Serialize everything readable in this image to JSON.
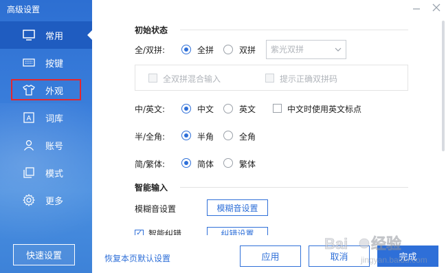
{
  "window": {
    "title": "高级设置"
  },
  "sidebar": {
    "items": [
      {
        "label": "常用",
        "icon": "monitor-icon",
        "active": true
      },
      {
        "label": "按键",
        "icon": "keyboard-icon",
        "active": false
      },
      {
        "label": "外观",
        "icon": "tshirt-icon",
        "active": false
      },
      {
        "label": "词库",
        "icon": "lexicon-icon",
        "active": false
      },
      {
        "label": "账号",
        "icon": "user-icon",
        "active": false
      },
      {
        "label": "模式",
        "icon": "mode-icon",
        "active": false
      },
      {
        "label": "更多",
        "icon": "gear-icon",
        "active": false
      }
    ],
    "quick_settings_label": "快速设置"
  },
  "main": {
    "initial_state": {
      "title": "初始状态",
      "pinyin_mode": {
        "label": "全/双拼:",
        "options": [
          "全拼",
          "双拼"
        ],
        "selected": "全拼",
        "scheme_select": "紫光双拼"
      },
      "mixed_input_label": "全双拼混合输入",
      "hint_correct_label": "提示正确双拼码",
      "lang": {
        "label": "中/英文:",
        "options": [
          "中文",
          "英文"
        ],
        "selected": "中文",
        "punct_checkbox_label": "中文时使用英文标点"
      },
      "width": {
        "label": "半/全角:",
        "options": [
          "半角",
          "全角"
        ],
        "selected": "半角"
      },
      "script": {
        "label": "简/繁体:",
        "options": [
          "简体",
          "繁体"
        ],
        "selected": "简体"
      }
    },
    "smart_input": {
      "title": "智能输入",
      "fuzzy_label": "模糊音设置",
      "fuzzy_button": "模糊音设置",
      "smart_correct_label": "智能纠错",
      "correct_button": "纠错设置"
    }
  },
  "footer": {
    "restore_link": "恢复本页默认设置",
    "apply": "应用",
    "cancel": "取消",
    "done": "完成"
  },
  "colors": {
    "accent": "#2e6fd8",
    "sidebar": "#2d6fd2",
    "highlight": "#e4262d"
  },
  "watermark": {
    "brand": "Baidu",
    "sub": "经验",
    "url": "jingyan.baidu.com"
  }
}
